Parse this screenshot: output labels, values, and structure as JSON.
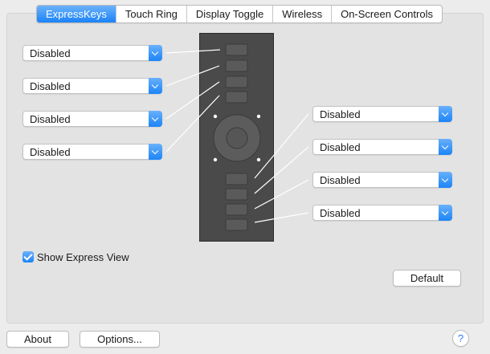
{
  "tabs": [
    {
      "label": "ExpressKeys",
      "active": true
    },
    {
      "label": "Touch Ring",
      "active": false
    },
    {
      "label": "Display Toggle",
      "active": false
    },
    {
      "label": "Wireless",
      "active": false
    },
    {
      "label": "On-Screen Controls",
      "active": false
    }
  ],
  "left_keys": [
    {
      "value": "Disabled"
    },
    {
      "value": "Disabled"
    },
    {
      "value": "Disabled"
    },
    {
      "value": "Disabled"
    }
  ],
  "right_keys": [
    {
      "value": "Disabled"
    },
    {
      "value": "Disabled"
    },
    {
      "value": "Disabled"
    },
    {
      "value": "Disabled"
    }
  ],
  "show_express_view": {
    "label": "Show Express View",
    "checked": true
  },
  "buttons": {
    "default": "Default",
    "about": "About",
    "options": "Options...",
    "help": "?"
  },
  "colors": {
    "accent": "#1a83f8",
    "tablet": "#4a4a4a",
    "tablet_key": "#5b5b5b"
  },
  "icons": {
    "dropdown": "chevron-down-icon",
    "check": "checkmark-icon"
  }
}
